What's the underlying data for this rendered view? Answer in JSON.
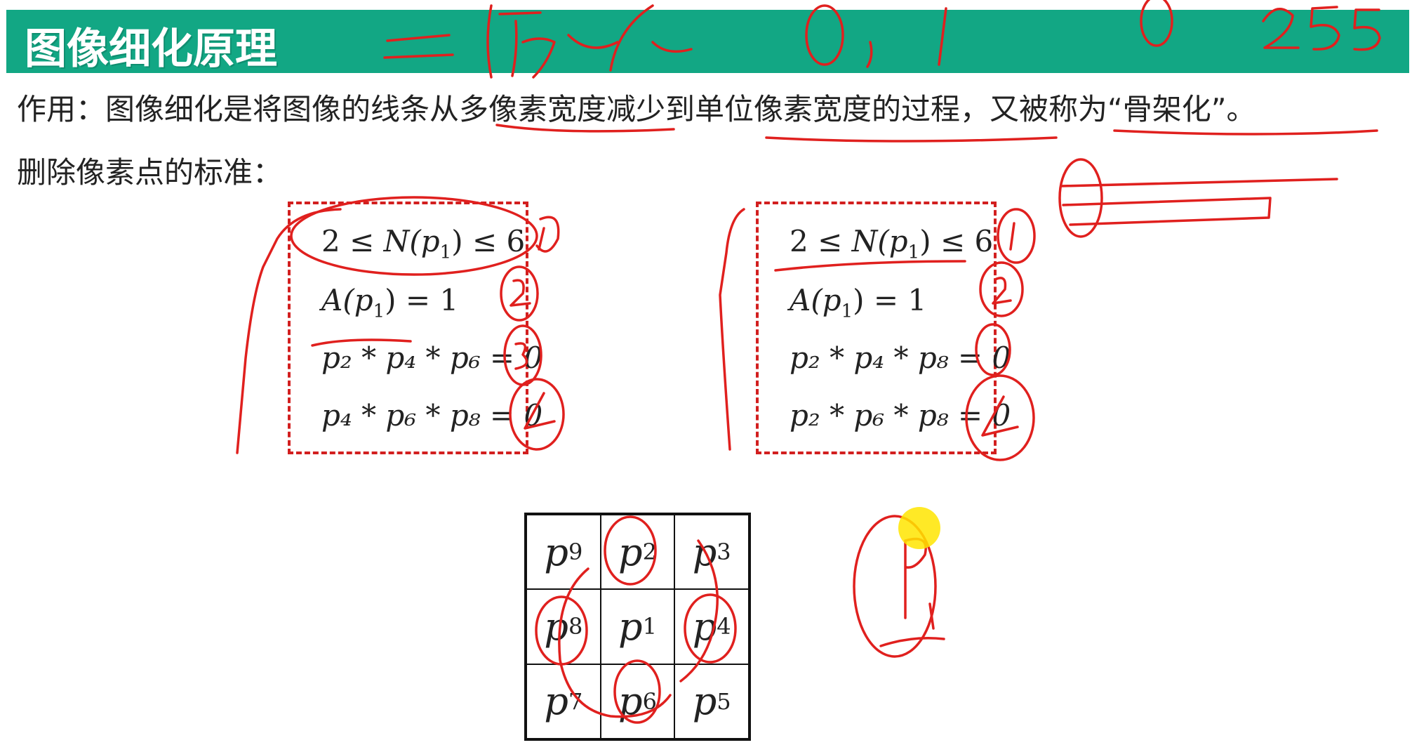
{
  "header": {
    "title": "图像细化原理"
  },
  "intro": {
    "line1": "作用：图像细化是将图像的线条从多像素宽度减少到单位像素宽度的过程，又被称为“骨架化”。",
    "line2": "删除像素点的标准："
  },
  "left_box": {
    "conditions": [
      {
        "pre": "2 ≤ ",
        "var": "N",
        "paren": "(p",
        "sub": "1",
        "post": ") ≤ 6"
      },
      {
        "pre": "",
        "var": "A",
        "paren": "(p",
        "sub": "1",
        "post": ") = 1"
      },
      {
        "text": "p₂ * p₄ * p₆ = 0"
      },
      {
        "text": "p₄ * p₆ * p₈ = 0"
      }
    ]
  },
  "right_box": {
    "conditions": [
      {
        "pre": "2 ≤ ",
        "var": "N",
        "paren": "(p",
        "sub": "1",
        "post": ") ≤ 6"
      },
      {
        "pre": "",
        "var": "A",
        "paren": "(p",
        "sub": "1",
        "post": ") = 1"
      },
      {
        "text": "p₂ * p₄ * p₈ = 0"
      },
      {
        "text": "p₂ * p₆ * p₈ = 0"
      }
    ]
  },
  "neighborhood": {
    "cells": [
      {
        "sym": "p",
        "sub": "9"
      },
      {
        "sym": "p",
        "sub": "2"
      },
      {
        "sym": "p",
        "sub": "3"
      },
      {
        "sym": "p",
        "sub": "8"
      },
      {
        "sym": "p",
        "sub": "1"
      },
      {
        "sym": "p",
        "sub": "4"
      },
      {
        "sym": "p",
        "sub": "7"
      },
      {
        "sym": "p",
        "sub": "6"
      },
      {
        "sym": "p",
        "sub": "5"
      }
    ]
  },
  "annotations": {
    "ink_color": "#e0201e",
    "handwritten": [
      "二值化",
      "0, 1",
      "0",
      "255",
      "①",
      "②",
      "③",
      "④",
      "P1"
    ]
  },
  "colors": {
    "title_bar": "#12a784",
    "dashed_box": "#d21f1f",
    "cursor": "#ffe500"
  }
}
